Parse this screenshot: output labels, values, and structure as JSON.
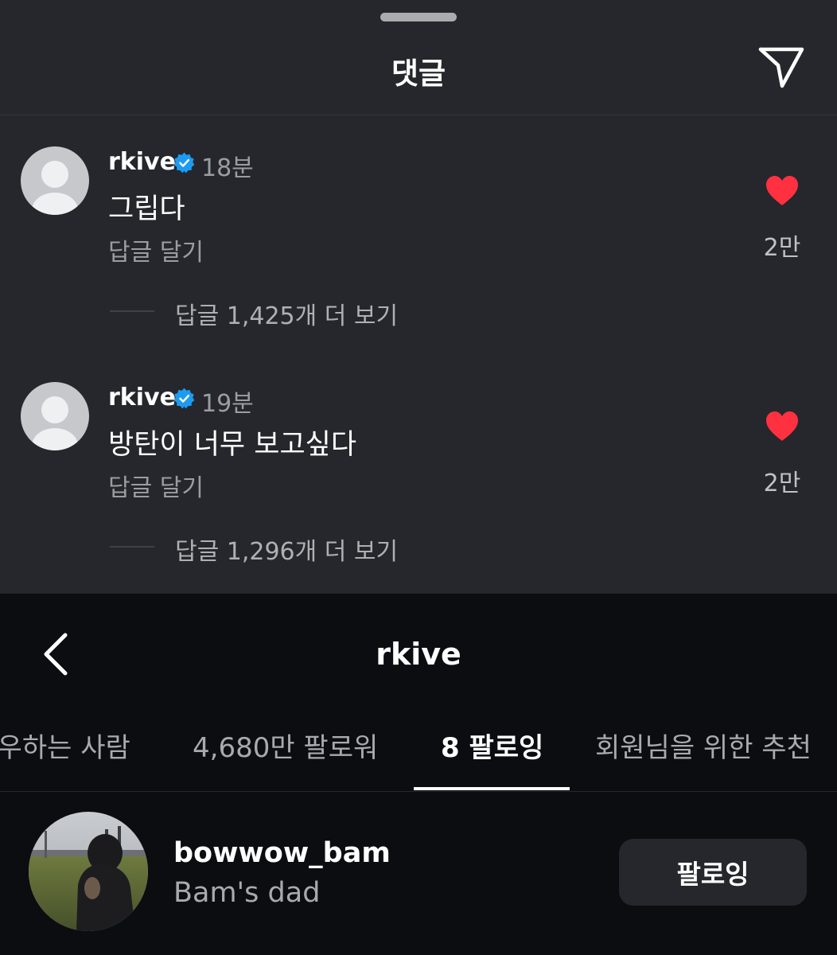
{
  "comments_sheet": {
    "title": "댓글",
    "comments": [
      {
        "username": "rkive",
        "time": "18분",
        "text": "그립다",
        "reply_label": "답글 달기",
        "likes": "2만",
        "view_replies": "답글 1,425개 더 보기"
      },
      {
        "username": "rkive",
        "time": "19분",
        "text": "방탄이 너무 보고싶다",
        "reply_label": "답글 달기",
        "likes": "2만",
        "view_replies": "답글 1,296개 더 보기"
      }
    ]
  },
  "profile": {
    "title": "rkive",
    "tabs": [
      {
        "label": "팔로우하는 사람",
        "active": false
      },
      {
        "label": "4,680만 팔로워",
        "active": false
      },
      {
        "label": "8 팔로잉",
        "active": true
      },
      {
        "label": "회원님을 위한 추천",
        "active": false
      }
    ],
    "following": [
      {
        "username": "bowwow_bam",
        "subtitle": "Bam's dad",
        "button_label": "팔로잉"
      }
    ]
  },
  "colors": {
    "sheet_bg": "#25272c",
    "page_bg": "#0b0d11",
    "heart": "#ff3040",
    "verified": "#1d9bf0",
    "muted_text": "#9b9da1"
  },
  "icons": [
    "share-icon",
    "verified-badge-icon",
    "heart-icon",
    "back-chevron-icon"
  ]
}
